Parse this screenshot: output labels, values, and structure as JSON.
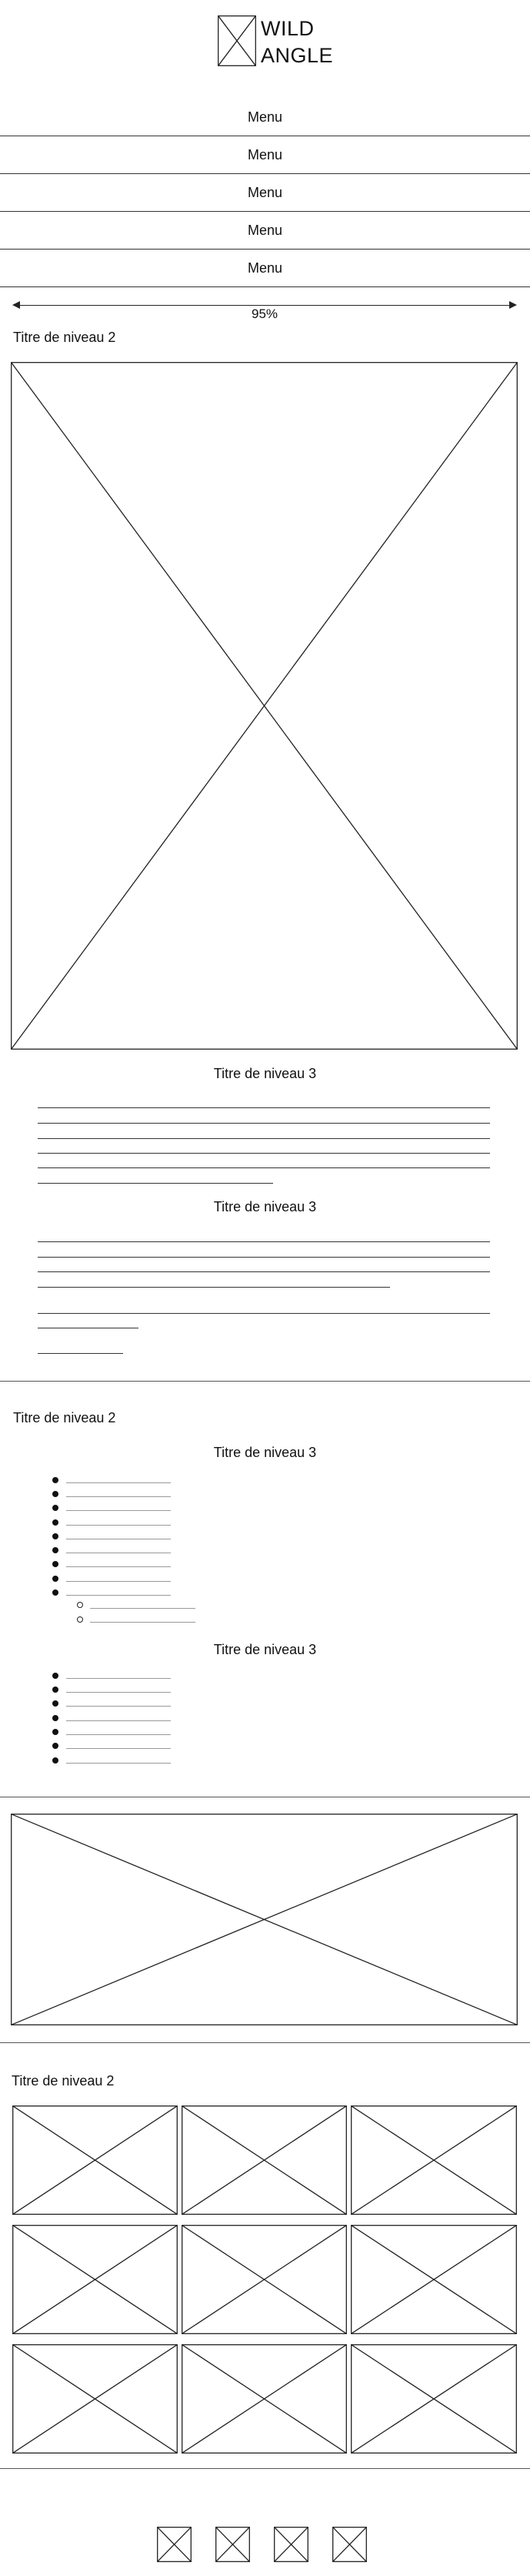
{
  "header": {
    "logo_line1": "WILD",
    "logo_line2": "ANGLE"
  },
  "nav": {
    "items": [
      {
        "label": "Menu"
      },
      {
        "label": "Menu"
      },
      {
        "label": "Menu"
      },
      {
        "label": "Menu"
      },
      {
        "label": "Menu"
      }
    ]
  },
  "width_indicator": {
    "label": "95%"
  },
  "section1": {
    "title": "Titre de niveau 2",
    "subtitle_a": "Titre de niveau 3",
    "subtitle_b": "Titre de niveau 3"
  },
  "section2": {
    "title": "Titre de niveau 2",
    "subtitle_a": "Titre de niveau 3",
    "subtitle_b": "Titre de niveau 3"
  },
  "section3": {
    "title": "Titre de niveau 2"
  }
}
